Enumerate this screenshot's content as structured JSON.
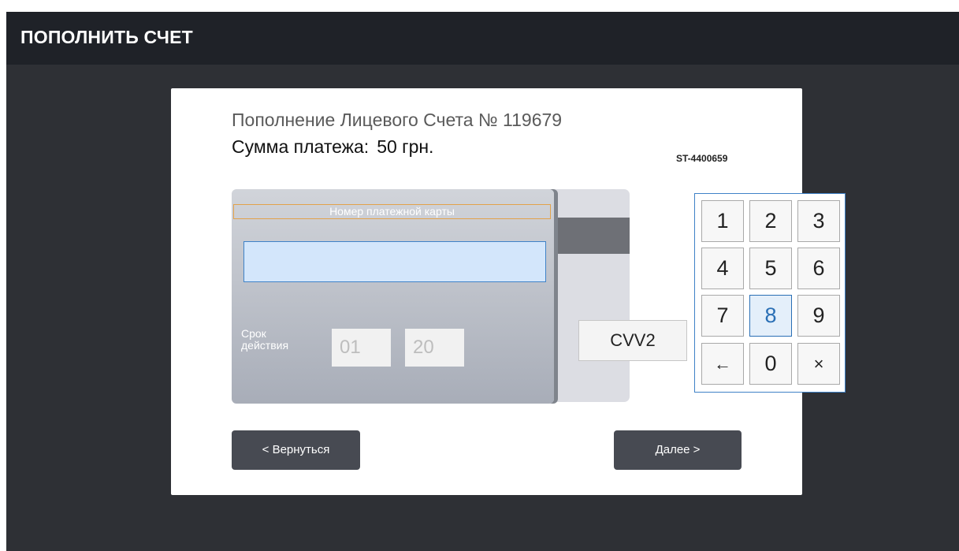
{
  "header": {
    "title": "ПОПОЛНИТЬ СЧЕТ"
  },
  "payment": {
    "account_line": "Пополнение Лицевого Счета № 119679",
    "amount_label": "Сумма платежа:",
    "amount_value": "50 грн.",
    "terminal_id": "ST-4400659"
  },
  "card": {
    "number_label": "Номер платежной карты",
    "number_value": "",
    "expiry_label": "Срок действия",
    "expiry_month": "01",
    "expiry_year": "20",
    "cvv_label": "CVV2"
  },
  "keypad": {
    "keys": [
      "1",
      "2",
      "3",
      "4",
      "5",
      "6",
      "7",
      "8",
      "9",
      "←",
      "0",
      "×"
    ],
    "active_key": "8"
  },
  "actions": {
    "back_label": "< Вернуться",
    "next_label": "Далее >"
  },
  "colors": {
    "background": "#2e3035",
    "topbar": "#1f2228",
    "accent": "#3f82c7",
    "button": "#474a52"
  }
}
